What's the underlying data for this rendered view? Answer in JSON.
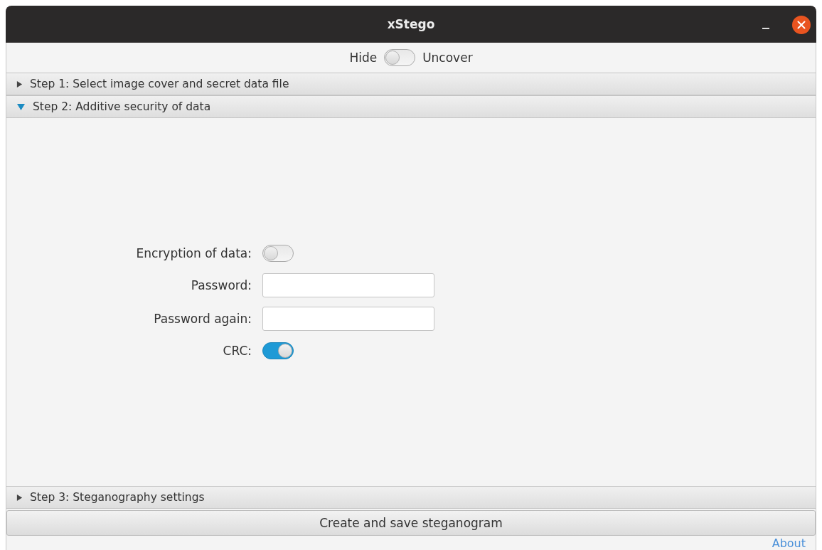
{
  "window": {
    "title": "xStego"
  },
  "mode_switch": {
    "left_label": "Hide",
    "right_label": "Uncover",
    "on": false
  },
  "sections": [
    {
      "title": "Step 1: Select image cover and secret data file",
      "expanded": false
    },
    {
      "title": "Step 2: Additive security of data",
      "expanded": true,
      "fields": [
        {
          "kind": "toggle",
          "label": "Encryption of data:",
          "on": false
        },
        {
          "kind": "text",
          "label": "Password:"
        },
        {
          "kind": "text",
          "label": "Password again:"
        },
        {
          "kind": "toggle",
          "label": "CRC:",
          "on": true
        }
      ]
    },
    {
      "title": "Step 3: Steganography settings",
      "expanded": false
    }
  ],
  "action_button": "Create and save steganogram",
  "about_link": "About"
}
